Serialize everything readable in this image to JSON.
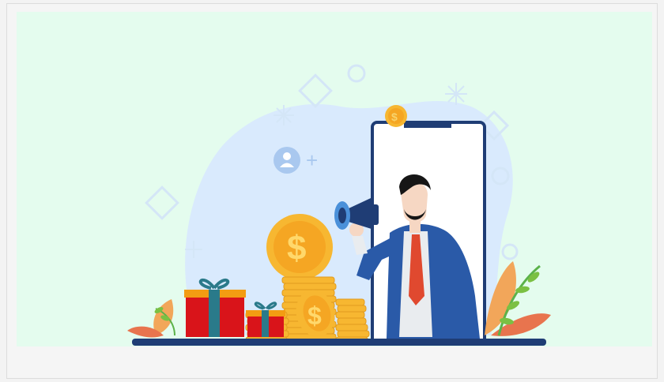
{
  "illustration": {
    "subject": "businessman-with-megaphone-promotion",
    "colors": {
      "background": "#e4fcee",
      "blob": "#d9eafd",
      "phone_frame": "#1f3d75",
      "suit": "#2a5aa8",
      "tie": "#e0492f",
      "coin": "#f7b731",
      "gift_red": "#d9141a",
      "gift_ribbon": "#2a7a8a",
      "floor": "#1f3d75"
    },
    "icons": [
      "coin-icon",
      "add-user-icon",
      "megaphone-icon",
      "gift-box-icon",
      "coin-stack-icon",
      "plant-icon"
    ],
    "coin_symbol": "$",
    "add_user_symbol": "+"
  }
}
